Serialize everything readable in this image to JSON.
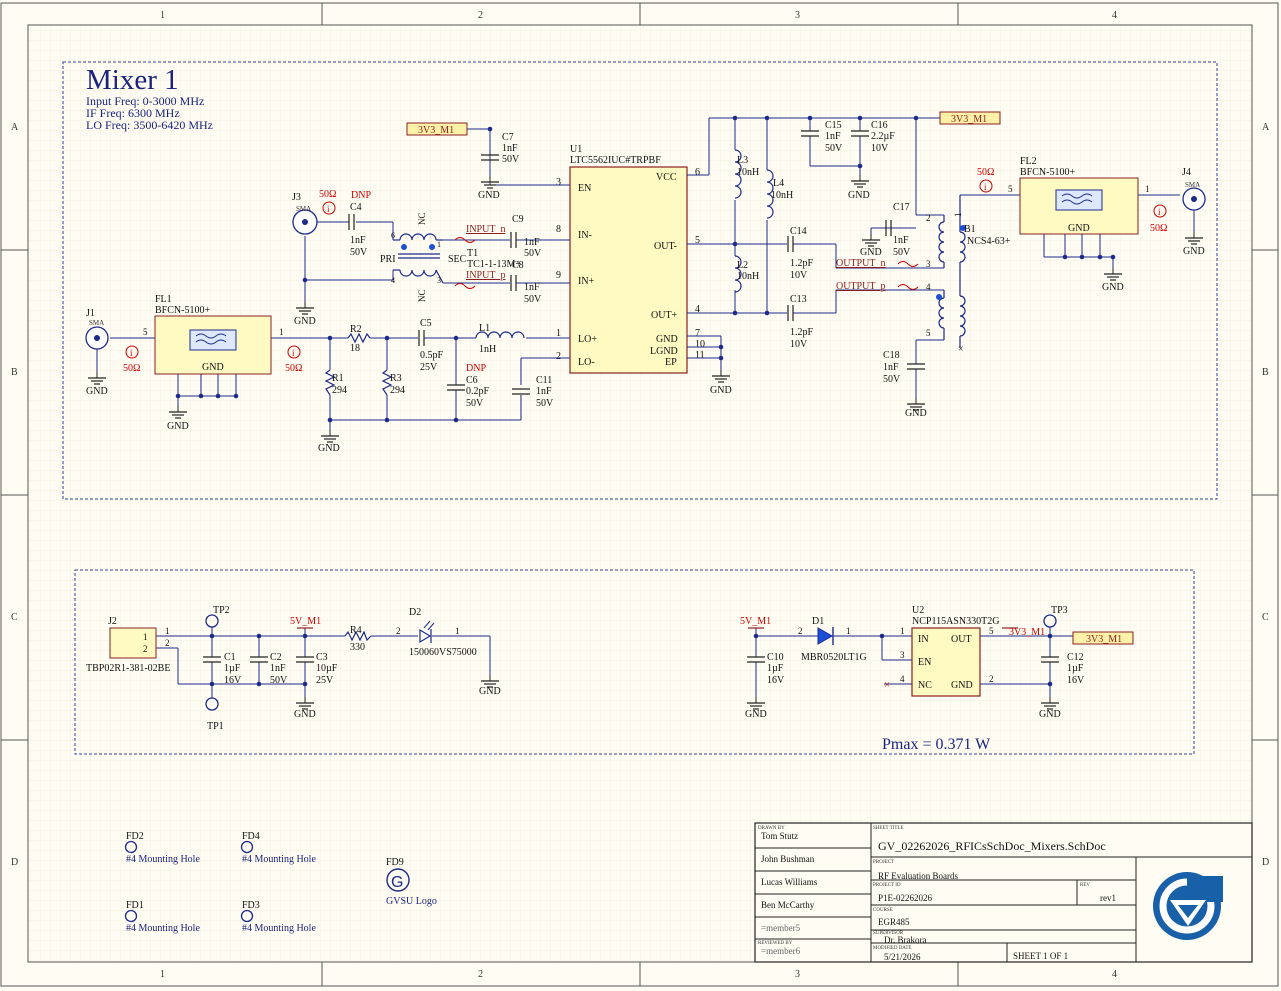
{
  "border": {
    "cols": [
      "1",
      "2",
      "3",
      "4"
    ],
    "rows": [
      "A",
      "B",
      "C",
      "D"
    ]
  },
  "mixer": {
    "title": "Mixer 1",
    "specs": [
      "Input Freq: 0-3000 MHz",
      "IF Freq: 6300 MHz",
      "LO Freq: 3500-6420 MHz"
    ],
    "u1": {
      "ref": "U1",
      "part": "LTC5562IUC#TRPBF",
      "left_pins": [
        [
          "3",
          "EN"
        ],
        [
          "8",
          "IN-"
        ],
        [
          "9",
          "IN+"
        ],
        [
          "1",
          "LO+"
        ],
        [
          "2",
          "LO-"
        ]
      ],
      "right_pins": [
        [
          "6",
          "VCC"
        ],
        [
          "5",
          "OUT-"
        ],
        [
          "4",
          "OUT+"
        ],
        [
          "7",
          "GND"
        ],
        [
          "10",
          "LGND"
        ],
        [
          "11",
          "EP"
        ]
      ]
    },
    "net_3v3": "3V3_M1",
    "gnd": "GND",
    "dnp": "DNP",
    "sma": "SMA",
    "ohm50": "50Ω",
    "info": "i",
    "j3": "J3",
    "j1": "J1",
    "j4": "J4",
    "c7": [
      "C7",
      "1nF",
      "50V"
    ],
    "c4": [
      "C4",
      "1nF",
      "50V"
    ],
    "c9": [
      "C9",
      "1nF",
      "50V"
    ],
    "c8": [
      "C8",
      "1nF",
      "50V"
    ],
    "c5": [
      "C5",
      "0.5pF",
      "25V"
    ],
    "c6": [
      "C6",
      "0.2pF",
      "50V"
    ],
    "c11": [
      "C11",
      "1nF",
      "50V"
    ],
    "c14": [
      "C14",
      "1.2pF",
      "10V"
    ],
    "c13": [
      "C13",
      "1.2pF",
      "10V"
    ],
    "c15": [
      "C15",
      "1nF",
      "50V"
    ],
    "c16": [
      "C16",
      "2.2µF",
      "10V"
    ],
    "c17": [
      "C17",
      "1nF",
      "50V"
    ],
    "c18": [
      "C18",
      "1nF",
      "50V"
    ],
    "l1": [
      "L1",
      "1nH"
    ],
    "l2": [
      "L2",
      "10nH"
    ],
    "l3": [
      "L3",
      "10nH"
    ],
    "l4": [
      "L4",
      "10nH"
    ],
    "r1": [
      "R1",
      "294"
    ],
    "r2": [
      "R2",
      "18"
    ],
    "r3": [
      "R3",
      "294"
    ],
    "t1": [
      "T1",
      "TC1-1-13M+"
    ],
    "b1": [
      "B1",
      "NCS4-63+"
    ],
    "fl1": [
      "FL1",
      "BFCN-5100+"
    ],
    "fl2": [
      "FL2",
      "BFCN-5100+"
    ],
    "pri": "PRI",
    "sec": "SEC",
    "nc": "NC",
    "input_n": "INPUT_n",
    "input_p": "INPUT_p",
    "output_n": "OUTPUT_n",
    "output_p": "OUTPUT_p",
    "pin": {
      "p1": "1",
      "p2": "2",
      "p3": "3",
      "p4": "4",
      "p5": "5",
      "p6": "6",
      "p7": "7",
      "p8": "8"
    }
  },
  "power": {
    "j2": [
      "J2",
      "TBP02R1-381-02BE"
    ],
    "tp1": "TP1",
    "tp2": "TP2",
    "tp3": "TP3",
    "net_5v": "5V_M1",
    "c1": [
      "C1",
      "1µF",
      "16V"
    ],
    "c2": [
      "C2",
      "1nF",
      "50V"
    ],
    "c3": [
      "C3",
      "10µF",
      "25V"
    ],
    "r4": [
      "R4",
      "330"
    ],
    "d2": [
      "D2",
      "150060VS75000"
    ],
    "d1": [
      "D1",
      "MBR0520LT1G"
    ],
    "c10": [
      "C10",
      "1µF",
      "16V"
    ],
    "c12": [
      "C12",
      "1µF",
      "16V"
    ],
    "u2": {
      "ref": "U2",
      "part": "NCP115ASN330T2G",
      "in": "IN",
      "en": "EN",
      "nc": "NC",
      "out": "OUT",
      "gnd": "GND"
    },
    "pmax": "Pmax = 0.371 W"
  },
  "mounting": {
    "fd2": "FD2",
    "fd4": "FD4",
    "fd1": "FD1",
    "fd3": "FD3",
    "fd9": "FD9",
    "hole": "#4 Mounting Hole",
    "logo": "GVSU Logo",
    "logo_glyph": "G"
  },
  "title_block": {
    "drawn_by_h": "DRAWN BY",
    "members": [
      "Tom Stutz",
      "John Bushman",
      "Lucas Williams",
      "Ben McCarthy",
      "=member5"
    ],
    "reviewed_h": "REVIEWED BY",
    "member6": "=member6",
    "sheet_title_h": "SHEET TITLE",
    "sheet_title": "GV_02262026_RFICsSchDoc_Mixers.SchDoc",
    "project_h": "PROJECT",
    "project": "RF Evaluation Boards",
    "project_id_h": "PROJECT ID",
    "project_id": "P1E-02262026",
    "rev_h": "REV",
    "rev": "rev1",
    "course_h": "COURSE",
    "course": "EGR485",
    "supervisor_h": "SUPERVISOR",
    "supervisor": "Dr. Brakora",
    "modified_h": "MODIFIED DATE",
    "modified": "5/21/2026",
    "sheet": "SHEET  1    OF  1"
  }
}
